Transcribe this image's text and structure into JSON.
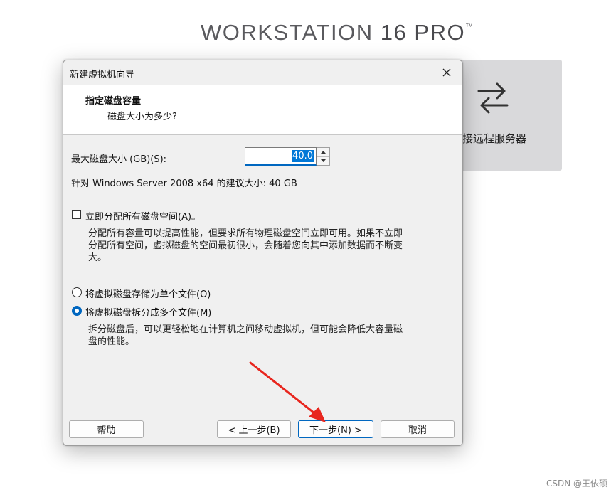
{
  "brand": {
    "prefix": "WORKSTATION ",
    "version": "16",
    "edition": " PRO",
    "trademark": "™"
  },
  "remote_card": {
    "label": "接远程服务器",
    "icon": "swap-arrows-icon"
  },
  "dialog": {
    "title": "新建虚拟机向导",
    "close_icon": "close-icon",
    "header": {
      "title": "指定磁盘容量",
      "subtitle": "磁盘大小为多少?"
    },
    "max_size_label": "最大磁盘大小 (GB)(S):",
    "max_size_value": "40.0",
    "recommendation": "针对 Windows Server 2008 x64 的建议大小: 40 GB",
    "allocate": {
      "label": "立即分配所有磁盘空间(A)。",
      "checked": false,
      "desc_line1": "分配所有容量可以提高性能，但要求所有物理磁盘空间立即可用。如果不立即",
      "desc_line2": "分配所有空间，虚拟磁盘的空间最初很小，会随着您向其中添加数据而不断变",
      "desc_line3": "大。"
    },
    "storage_options": [
      {
        "label": "将虚拟磁盘存储为单个文件(O)",
        "selected": false
      },
      {
        "label": "将虚拟磁盘拆分成多个文件(M)",
        "selected": true
      }
    ],
    "split_desc_line1": "拆分磁盘后，可以更轻松地在计算机之间移动虚拟机，但可能会降低大容量磁",
    "split_desc_line2": "盘的性能。",
    "buttons": {
      "help": "帮助",
      "back": "< 上一步(B)",
      "next": "下一步(N) >",
      "cancel": "取消"
    }
  },
  "annotation": {
    "arrow_color": "#e8261e"
  },
  "watermark": "CSDN @王依硕"
}
